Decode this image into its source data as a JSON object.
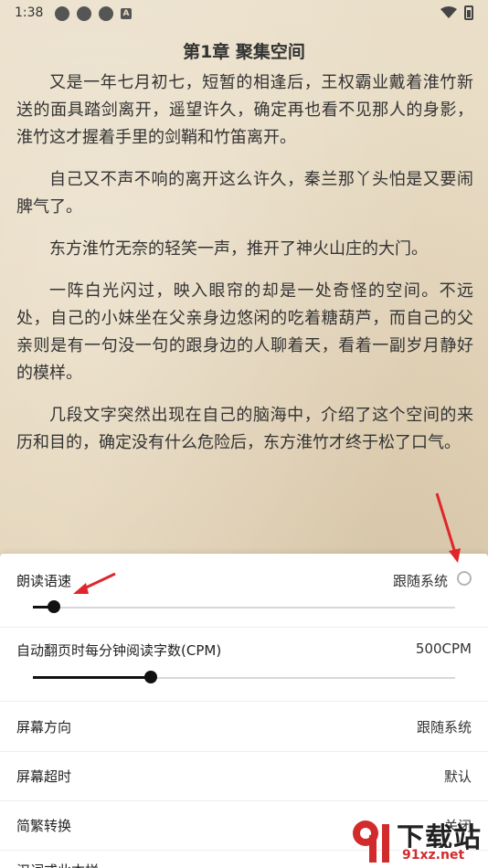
{
  "status_bar": {
    "time": "1:38",
    "notification_badge": "A"
  },
  "reader": {
    "chapter_title": "第1章 聚集空间",
    "paragraphs": [
      "又是一年七月初七，短暂的相逢后，王权霸业戴着淮竹新送的面具踏剑离开，遥望许久，确定再也看不见那人的身影，淮竹这才握着手里的剑鞘和竹笛离开。",
      "自己又不声不响的离开这么许久，秦兰那丫头怕是又要闹脾气了。",
      "东方淮竹无奈的轻笑一声，推开了神火山庄的大门。",
      "一阵白光闪过，映入眼帘的却是一处奇怪的空间。不远处，自己的小妹坐在父亲身边悠闲的吃着糖葫芦，而自己的父亲则是有一句没一句的跟身边的人聊着天，看着一副岁月静好的模样。",
      "几段文字突然出现在自己的脑海中，介绍了这个空间的来历和目的，确定没有什么危险后，东方淮竹才终于松了口气。"
    ]
  },
  "settings": {
    "reading_speed": {
      "label": "朗读语速",
      "follow_system_label": "跟随系统",
      "follow_system_checked": false,
      "slider_fraction": 0.05
    },
    "cpm": {
      "label": "自动翻页时每分钟阅读字数(CPM)",
      "value": "500CPM",
      "slider_fraction": 0.28
    },
    "screen_orientation": {
      "label": "屏幕方向",
      "value": "跟随系统"
    },
    "screen_timeout": {
      "label": "屏幕超时",
      "value": "默认"
    },
    "simplified_traditional": {
      "label": "简繁转换",
      "value": "关闭"
    },
    "partial_row": {
      "label": "汉词或此本样"
    }
  },
  "colors": {
    "accent": "#111111",
    "annotation_arrow": "#e0262b",
    "page_bg": "#e9dcc3",
    "panel_bg": "#ffffff"
  },
  "watermark": {
    "text": "下载站",
    "url": "91xz.net"
  }
}
